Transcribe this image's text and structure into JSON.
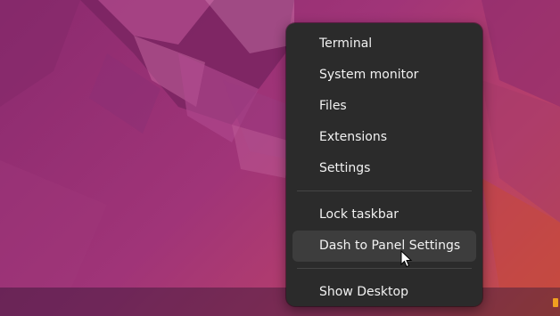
{
  "menu": {
    "items_group1": [
      {
        "label": "Terminal"
      },
      {
        "label": "System monitor"
      },
      {
        "label": "Files"
      },
      {
        "label": "Extensions"
      },
      {
        "label": "Settings"
      }
    ],
    "items_group2": [
      {
        "label": "Lock taskbar"
      },
      {
        "label": "Dash to Panel Settings",
        "hovered": true
      }
    ],
    "items_group3": [
      {
        "label": "Show Desktop"
      }
    ]
  },
  "colors": {
    "menu_background": "#2b2b2b",
    "hover_background": "#3d3d3d",
    "menu_text": "#f2f2f2",
    "wallpaper_base": "#a03478"
  },
  "icons": {
    "pointer": "mouse-pointer-icon",
    "tray": "tray-indicator-icon"
  }
}
